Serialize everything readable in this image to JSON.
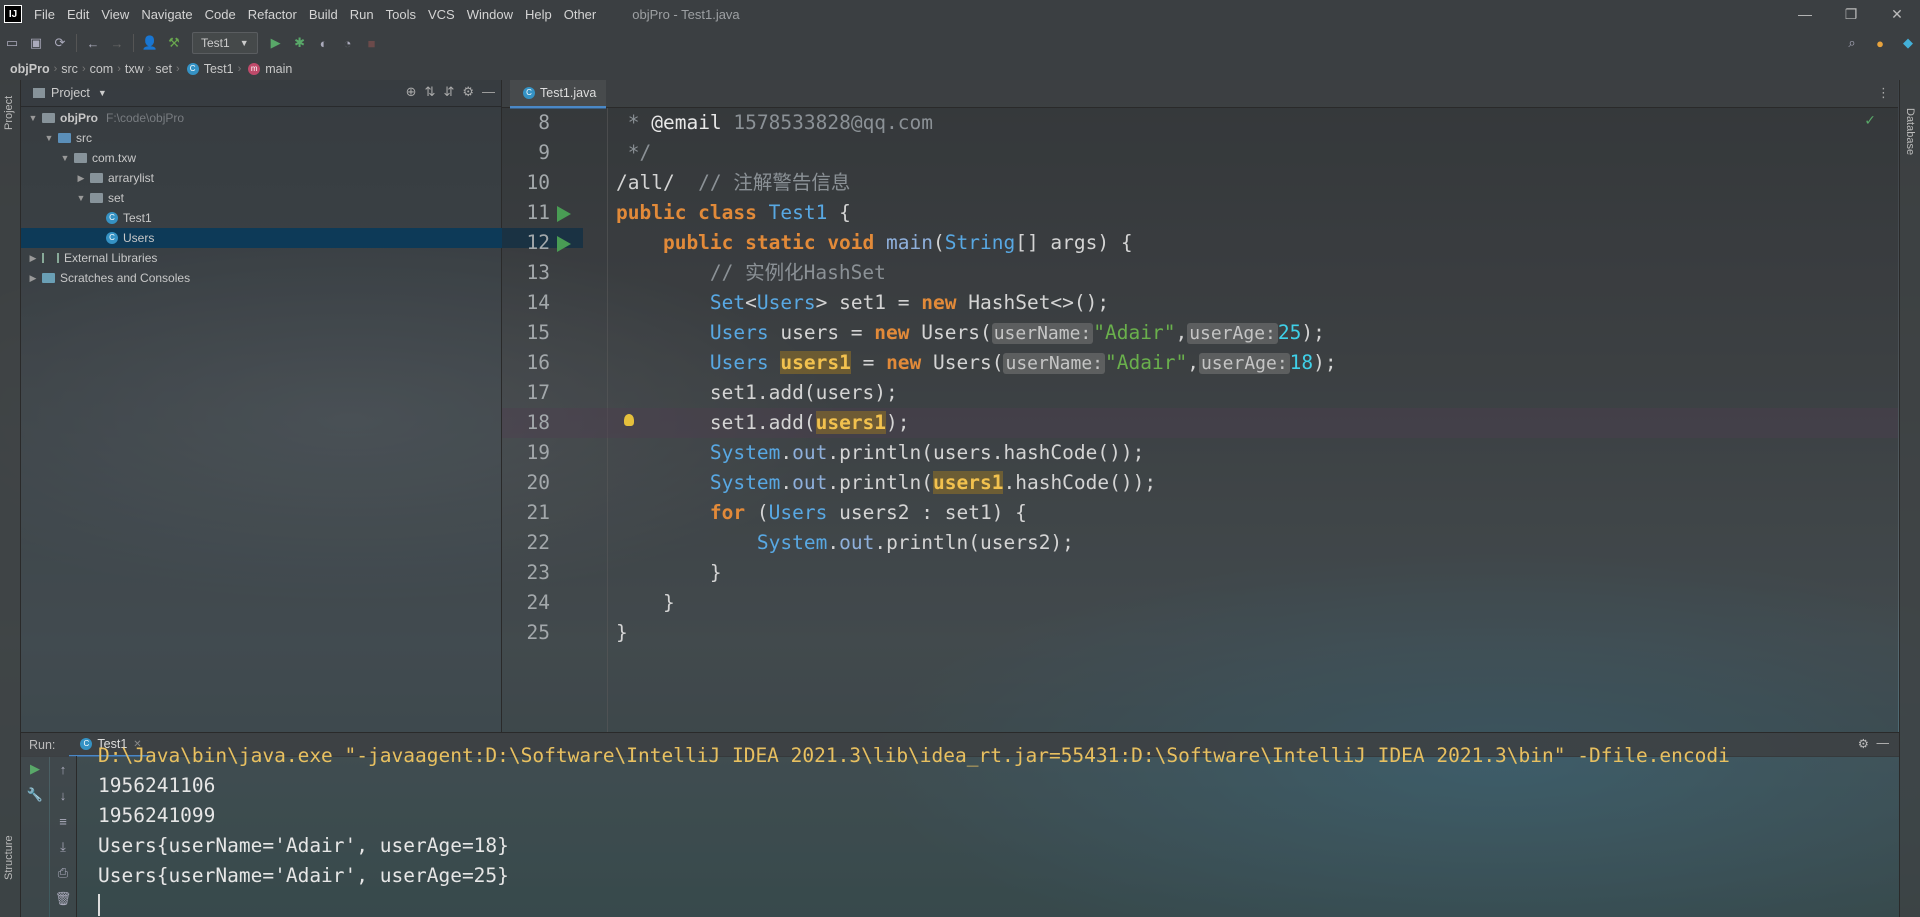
{
  "app": {
    "window_title": "objPro - Test1.java",
    "logo_text": "IJ",
    "menu": [
      "File",
      "Edit",
      "View",
      "Navigate",
      "Code",
      "Refactor",
      "Build",
      "Run",
      "Tools",
      "VCS",
      "Window",
      "Help",
      "Other"
    ]
  },
  "toolbar": {
    "run_config": "Test1"
  },
  "breadcrumb": [
    "objPro",
    "src",
    "com",
    "txw",
    "set",
    "Test1",
    "main"
  ],
  "stripes": {
    "left_top": "Project",
    "left_bottom": "Structure",
    "right": "Database"
  },
  "project": {
    "header": "Project",
    "tree": [
      {
        "label": "objPro",
        "hint": "F:\\code\\objPro",
        "depth": 0,
        "kind": "module",
        "expanded": true
      },
      {
        "label": "src",
        "depth": 1,
        "kind": "folder",
        "expanded": true
      },
      {
        "label": "com.txw",
        "depth": 2,
        "kind": "folder",
        "expanded": true
      },
      {
        "label": "arrarylist",
        "depth": 3,
        "kind": "folder",
        "expanded": false
      },
      {
        "label": "set",
        "depth": 3,
        "kind": "folder",
        "expanded": true
      },
      {
        "label": "Test1",
        "depth": 4,
        "kind": "class"
      },
      {
        "label": "Users",
        "depth": 4,
        "kind": "class",
        "selected": true
      },
      {
        "label": "External Libraries",
        "depth": 0,
        "kind": "lib",
        "expanded": false
      },
      {
        "label": "Scratches and Consoles",
        "depth": 0,
        "kind": "scratch",
        "expanded": false
      }
    ]
  },
  "editor": {
    "tab": "Test1.java",
    "line_numbers": [
      "8",
      "9",
      "10",
      "11",
      "12",
      "13",
      "14",
      "15",
      "16",
      "17",
      "18",
      "19",
      "20",
      "21",
      "22",
      "23",
      "24",
      "25"
    ],
    "lines": {
      "l8a": " * ",
      "l8b": "@email",
      "l8c": " 1578533828@qq.com",
      "l9": " */",
      "l10a": "/all/",
      "l10b": "  // 注解警告信息",
      "l11a": "public class ",
      "l11b": "Test1",
      "l11c": " {",
      "l12a": "    public static void ",
      "l12b": "main",
      "l12c": "(",
      "l12d": "String",
      "l12e": "[] args) {",
      "l13": "        // 实例化HashSet",
      "l14a": "        ",
      "l14b": "Set",
      "l14c": "<",
      "l14d": "Users",
      "l14e": "> set1 = ",
      "l14f": "new",
      "l14g": " HashSet<>();",
      "l15a": "        ",
      "l15b": "Users",
      "l15c": " users = ",
      "l15d": "new",
      "l15e": " Users(",
      "l15f": "userName:",
      "l15g": "\"Adair\"",
      "l15h": ",",
      "l15i": "userAge:",
      "l15j": "25",
      "l15k": ");",
      "l16a": "        ",
      "l16b": "Users",
      "l16c": " ",
      "l16d": "users1",
      "l16e": " = ",
      "l16f": "new",
      "l16g": " Users(",
      "l16h": "userName:",
      "l16i": "\"Adair\"",
      "l16j": ",",
      "l16k": "userAge:",
      "l16l": "18",
      "l16m": ");",
      "l17": "        set1.add(users);",
      "l18a": "        set1.add(",
      "l18b": "users1",
      "l18c": ");",
      "l19a": "        ",
      "l19b": "System",
      "l19c": ".",
      "l19d": "out",
      "l19e": ".println(users.hashCode());",
      "l20a": "        ",
      "l20b": "System",
      "l20c": ".",
      "l20d": "out",
      "l20e": ".println(",
      "l20f": "users1",
      "l20g": ".hashCode());",
      "l21a": "        ",
      "l21b": "for",
      "l21c": " (",
      "l21d": "Users",
      "l21e": " users2 : set1) {",
      "l22a": "            ",
      "l22b": "System",
      "l22c": ".",
      "l22d": "out",
      "l22e": ".println(users2);",
      "l23": "        }",
      "l24": "    }",
      "l25": "}"
    }
  },
  "run": {
    "label": "Run:",
    "tab": "Test1",
    "command": "D:\\Java\\bin\\java.exe \"-javaagent:D:\\Software\\IntelliJ IDEA 2021.3\\lib\\idea_rt.jar=55431:D:\\Software\\IntelliJ IDEA 2021.3\\bin\" -Dfile.encodi",
    "output": [
      "1956241106",
      "1956241099",
      "Users{userName='Adair', userAge=18}",
      "Users{userName='Adair', userAge=25}"
    ]
  }
}
